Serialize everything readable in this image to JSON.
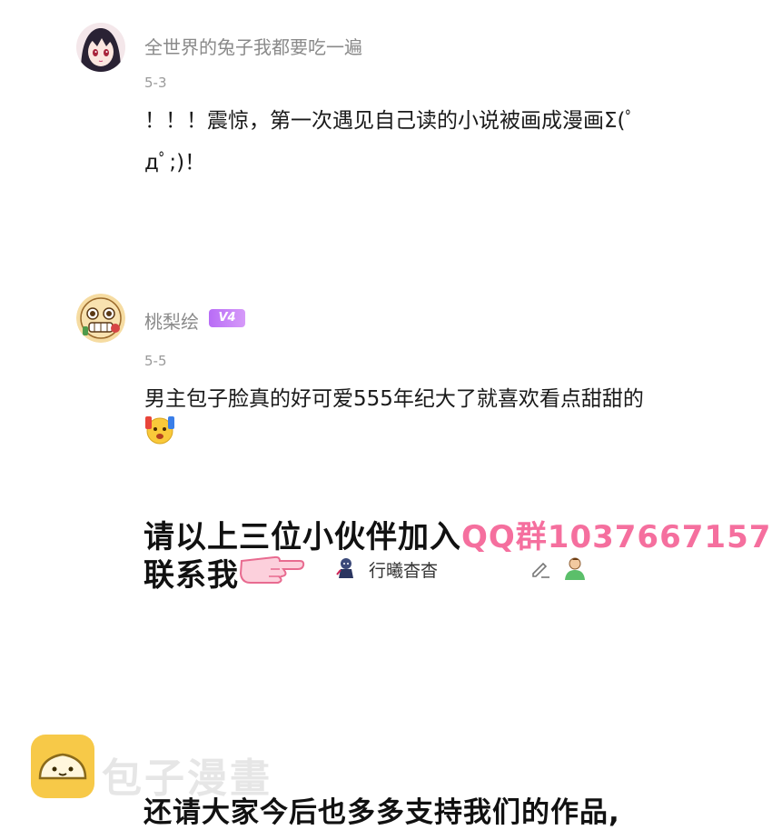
{
  "comments": [
    {
      "username": "全世界的兔子我都要吃一遍",
      "date": "5-3",
      "text": "！！！震惊，第一次遇见自己读的小说被画成漫画Σ(ﾟдﾟ;)！"
    },
    {
      "username": "桃梨绘",
      "badge": "V4",
      "date": "5-5",
      "text": "男主包子脸真的好可爱555年纪大了就喜欢看点甜甜的"
    }
  ],
  "banner": {
    "line1_prefix": "请以上三位小伙伴加入",
    "line1_highlight": "QQ群1037667157",
    "line2": "联系我"
  },
  "credit": {
    "name": "行曦杳杳"
  },
  "footer": {
    "text": "还请大家今后也多多支持我们的作品,"
  },
  "watermark": {
    "text": "包子漫畫"
  },
  "colors": {
    "highlight": "#f56f9e",
    "badge": "#b86cf6",
    "logo": "#f7c948"
  },
  "icons": [
    "pencil-icon",
    "user-icon",
    "pointing-hand-icon",
    "emoji-icon"
  ]
}
